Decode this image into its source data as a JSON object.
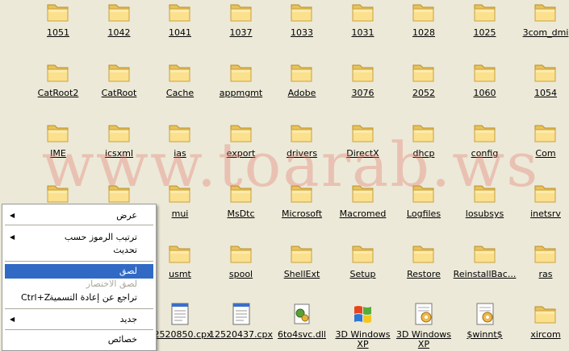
{
  "watermark": "www.toarab.ws",
  "items": [
    {
      "label": "1051",
      "icon": "folder"
    },
    {
      "label": "1042",
      "icon": "folder"
    },
    {
      "label": "1041",
      "icon": "folder"
    },
    {
      "label": "1037",
      "icon": "folder"
    },
    {
      "label": "1033",
      "icon": "folder"
    },
    {
      "label": "1031",
      "icon": "folder"
    },
    {
      "label": "1028",
      "icon": "folder"
    },
    {
      "label": "1025",
      "icon": "folder"
    },
    {
      "label": "3com_dmi",
      "icon": "folder"
    },
    {
      "label": "CatRoot2",
      "icon": "folder"
    },
    {
      "label": "CatRoot",
      "icon": "folder"
    },
    {
      "label": "Cache",
      "icon": "folder"
    },
    {
      "label": "appmgmt",
      "icon": "folder"
    },
    {
      "label": "Adobe",
      "icon": "folder"
    },
    {
      "label": "3076",
      "icon": "folder"
    },
    {
      "label": "2052",
      "icon": "folder"
    },
    {
      "label": "1060",
      "icon": "folder"
    },
    {
      "label": "1054",
      "icon": "folder"
    },
    {
      "label": "IME",
      "icon": "folder"
    },
    {
      "label": "icsxml",
      "icon": "folder"
    },
    {
      "label": "ias",
      "icon": "folder"
    },
    {
      "label": "export",
      "icon": "folder"
    },
    {
      "label": "drivers",
      "icon": "folder"
    },
    {
      "label": "DirectX",
      "icon": "folder"
    },
    {
      "label": "dhcp",
      "icon": "folder"
    },
    {
      "label": "config",
      "icon": "folder"
    },
    {
      "label": "Com",
      "icon": "folder"
    },
    {
      "label": "",
      "icon": "folder"
    },
    {
      "label": "",
      "icon": "folder"
    },
    {
      "label": "mui",
      "icon": "folder"
    },
    {
      "label": "MsDtc",
      "icon": "folder"
    },
    {
      "label": "Microsoft",
      "icon": "folder"
    },
    {
      "label": "Macromed",
      "icon": "folder"
    },
    {
      "label": "Logfiles",
      "icon": "folder"
    },
    {
      "label": "losubsys",
      "icon": "folder"
    },
    {
      "label": "inetsrv",
      "icon": "folder"
    },
    {
      "label": "",
      "icon": "folder"
    },
    {
      "label": "",
      "icon": "folder"
    },
    {
      "label": "usmt",
      "icon": "folder"
    },
    {
      "label": "spool",
      "icon": "folder"
    },
    {
      "label": "ShellExt",
      "icon": "folder"
    },
    {
      "label": "Setup",
      "icon": "folder"
    },
    {
      "label": "Restore",
      "icon": "folder"
    },
    {
      "label": "ReinstallBac...",
      "icon": "folder"
    },
    {
      "label": "ras",
      "icon": "folder"
    },
    {
      "label": "",
      "icon": "none"
    },
    {
      "label": "",
      "icon": "none"
    },
    {
      "label": "12520850.cpx",
      "icon": "document"
    },
    {
      "label": "12520437.cpx",
      "icon": "document"
    },
    {
      "label": "6to4svc.dll",
      "icon": "dll"
    },
    {
      "label": "3D Windows XP",
      "icon": "winxp"
    },
    {
      "label": "3D Windows XP",
      "icon": "config-file"
    },
    {
      "label": "$winnt$",
      "icon": "config-file"
    },
    {
      "label": "xircom",
      "icon": "folder"
    }
  ],
  "context_menu": [
    {
      "type": "item",
      "label": "عرض",
      "arrow": true,
      "state": "normal"
    },
    {
      "type": "sep"
    },
    {
      "type": "item",
      "label": "ترتيب الرموز حسب",
      "arrow": true,
      "state": "normal"
    },
    {
      "type": "item",
      "label": "تحديث",
      "arrow": false,
      "state": "normal"
    },
    {
      "type": "sep"
    },
    {
      "type": "item",
      "label": "لصق",
      "arrow": false,
      "state": "selected"
    },
    {
      "type": "item",
      "label": "لصق الاختصار",
      "arrow": false,
      "state": "disabled"
    },
    {
      "type": "item",
      "label": "تراجع عن إعادة التسمية",
      "shortcut": "Ctrl+Z",
      "arrow": false,
      "state": "normal"
    },
    {
      "type": "sep"
    },
    {
      "type": "item",
      "label": "جديد",
      "arrow": true,
      "state": "normal"
    },
    {
      "type": "sep"
    },
    {
      "type": "item",
      "label": "خصائص",
      "arrow": false,
      "state": "normal"
    }
  ]
}
